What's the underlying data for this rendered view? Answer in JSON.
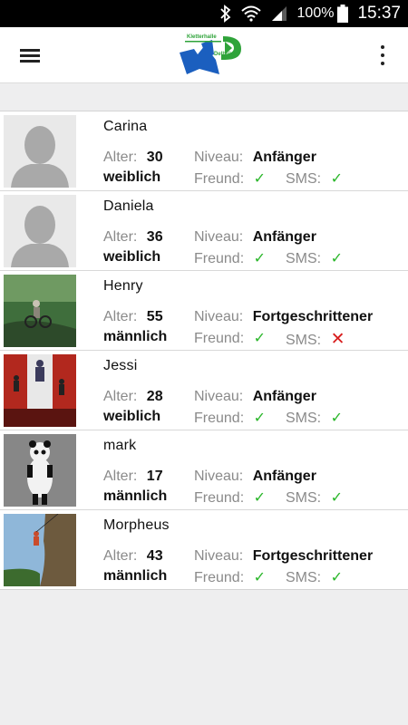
{
  "status_bar": {
    "battery_percent": "100%",
    "time": "15:37"
  },
  "app_bar": {
    "logo_line1": "Kletterhalle",
    "logo_line2": "Delbrück"
  },
  "labels": {
    "age": "Alter:",
    "level": "Niveau:",
    "friend": "Freund:",
    "sms": "SMS:"
  },
  "members": [
    {
      "name": "Carina",
      "age": "30",
      "gender": "weiblich",
      "level": "Anfänger",
      "friend": "✓",
      "sms": "✓",
      "avatar": "placeholder"
    },
    {
      "name": "Daniela",
      "age": "36",
      "gender": "weiblich",
      "level": "Anfänger",
      "friend": "✓",
      "sms": "✓",
      "avatar": "placeholder"
    },
    {
      "name": "Henry",
      "age": "55",
      "gender": "männlich",
      "level": "Fortgeschrittener",
      "friend": "✓",
      "sms": "✕",
      "avatar": "photo-bike"
    },
    {
      "name": "Jessi",
      "age": "28",
      "gender": "weiblich",
      "level": "Anfänger",
      "friend": "✓",
      "sms": "✓",
      "avatar": "photo-wall"
    },
    {
      "name": "mark",
      "age": "17",
      "gender": "männlich",
      "level": "Anfänger",
      "friend": "✓",
      "sms": "✓",
      "avatar": "photo-panda"
    },
    {
      "name": "Morpheus",
      "age": "43",
      "gender": "männlich",
      "level": "Fortgeschrittener",
      "friend": "✓",
      "sms": "✓",
      "avatar": "photo-cliff"
    }
  ],
  "colors": {
    "check": "#29b629",
    "cross": "#d81e1e",
    "label": "#8a8a8a",
    "logo_blue": "#1b5fbf",
    "logo_green": "#2fa33a"
  }
}
